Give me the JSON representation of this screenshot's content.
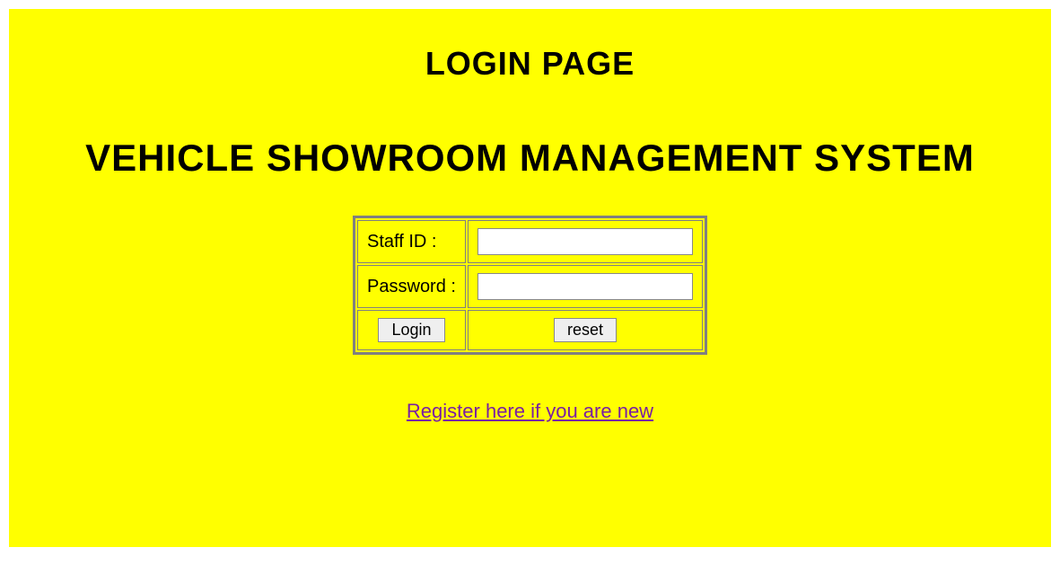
{
  "header": {
    "login_title": "LOGIN PAGE",
    "system_title": "VEHICLE SHOWROOM MANAGEMENT SYSTEM"
  },
  "form": {
    "staff_id_label": "Staff ID :",
    "staff_id_value": "",
    "password_label": "Password :",
    "password_value": "",
    "login_button": "Login",
    "reset_button": "reset"
  },
  "links": {
    "register_text": "Register here if you are new"
  }
}
